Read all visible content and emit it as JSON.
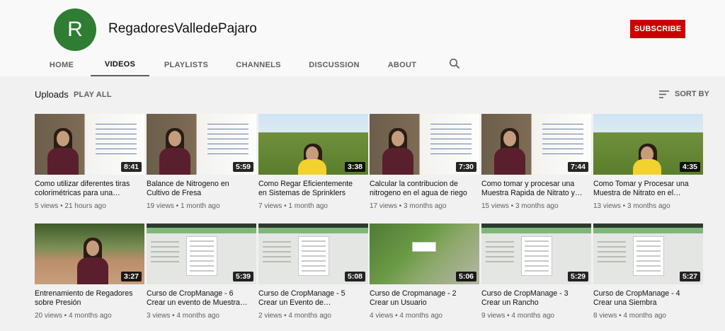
{
  "channel": {
    "avatar_letter": "R",
    "name": "RegadoresValledePajaro",
    "subscribe_label": "SUBSCRIBE",
    "colors": {
      "avatar": "#2e7d32",
      "subscribe": "#cc0000"
    }
  },
  "tabs": [
    {
      "label": "HOME",
      "active": false
    },
    {
      "label": "VIDEOS",
      "active": true
    },
    {
      "label": "PLAYLISTS",
      "active": false
    },
    {
      "label": "CHANNELS",
      "active": false
    },
    {
      "label": "DISCUSSION",
      "active": false
    },
    {
      "label": "ABOUT",
      "active": false
    }
  ],
  "search_icon": "search-icon",
  "uploads": {
    "label": "Uploads",
    "play_all": "PLAY ALL",
    "sort_by": "SORT BY",
    "sort_icon": "sort-icon"
  },
  "videos": [
    {
      "title": "Como utilizar diferentes tiras\ncolorimétricas para una…",
      "meta": "5 views • 21 hours ago",
      "duration": "8:41",
      "scene": "board"
    },
    {
      "title": "Balance de Nitrogeno en\nCultivo de Fresa",
      "meta": "19 views • 1 month ago",
      "duration": "5:59",
      "scene": "board"
    },
    {
      "title": "Como Regar Eficientemente\nen Sistemas de Sprinklers",
      "meta": "7 views • 1 month ago",
      "duration": "3:38",
      "scene": "field"
    },
    {
      "title": "Calcular la contribucion de\nnitrogeno en el agua de riego",
      "meta": "17 views • 3 months ago",
      "duration": "7:30",
      "scene": "board"
    },
    {
      "title": "Como tomar y procesar una\nMuestra Rapida de Nitrato y…",
      "meta": "15 views • 3 months ago",
      "duration": "7:44",
      "scene": "board"
    },
    {
      "title": "Como Tomar y Procesar una\nMuestra de Nitrato en el…",
      "meta": "13 views • 3 months ago",
      "duration": "4:35",
      "scene": "field"
    },
    {
      "title": "Entrenamiento de Regadores\nsobre Presión",
      "meta": "20 views • 4 months ago",
      "duration": "3:27",
      "scene": "soil"
    },
    {
      "title": "Curso de CropManage - 6\nCrear un evento de Muestra…",
      "meta": "3 views • 4 months ago",
      "duration": "5:39",
      "scene": "app"
    },
    {
      "title": "Curso de CropManage - 5\nCrear un Evento de…",
      "meta": "2 views • 4 months ago",
      "duration": "5:08",
      "scene": "app"
    },
    {
      "title": "Curso de Cropmanage - 2\nCrear un Usuario",
      "meta": "4 views • 4 months ago",
      "duration": "5:06",
      "scene": "aerial"
    },
    {
      "title": "Curso de CropManage - 3\nCrear un Rancho",
      "meta": "9 views • 4 months ago",
      "duration": "5:29",
      "scene": "app"
    },
    {
      "title": "Curso de CropManage - 4\nCrear una Siembra",
      "meta": "8 views • 4 months ago",
      "duration": "5:27",
      "scene": "app"
    }
  ]
}
